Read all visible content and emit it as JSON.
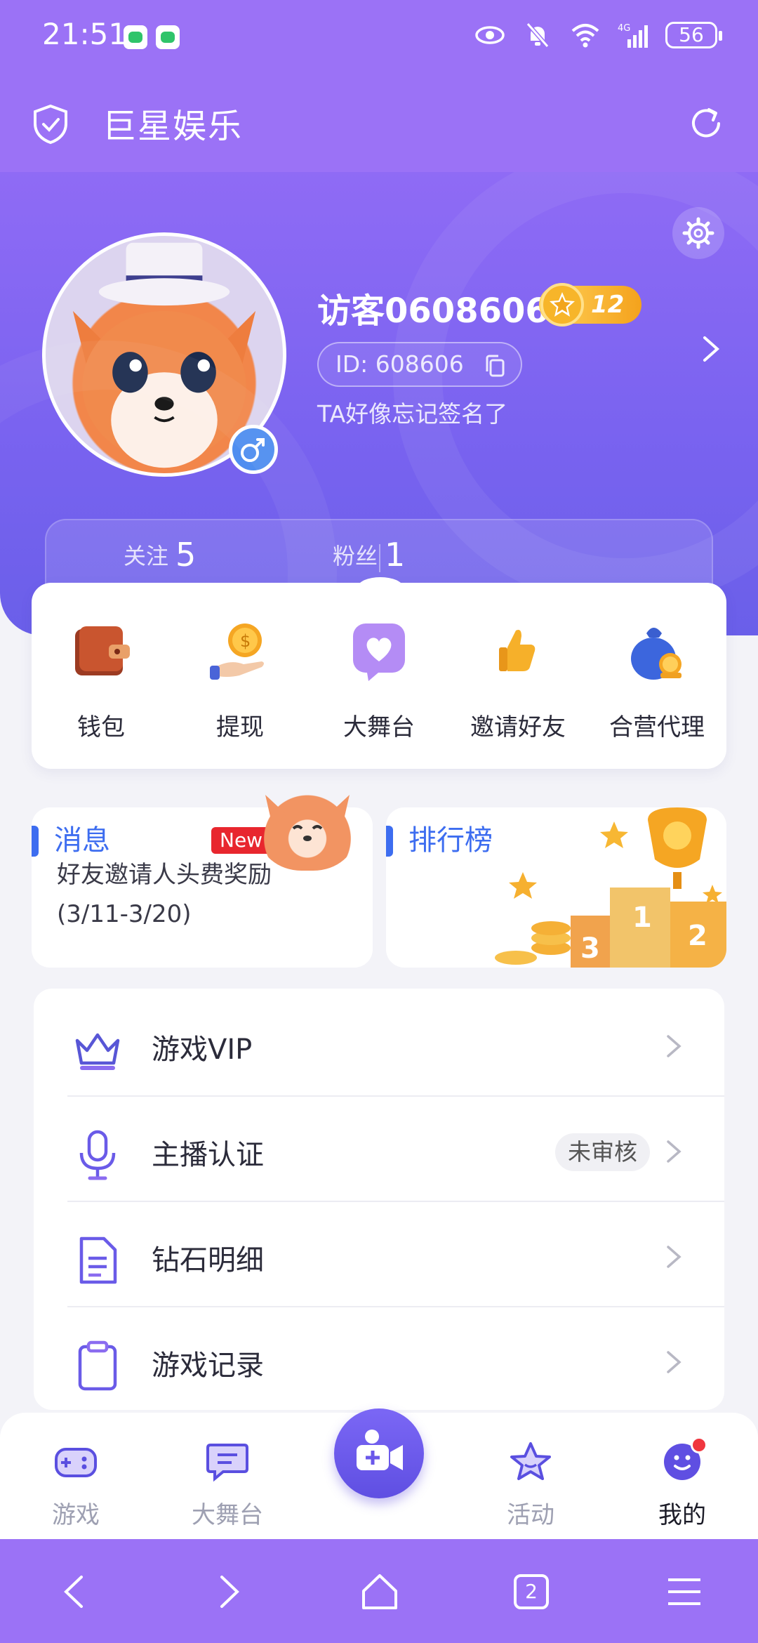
{
  "status_bar": {
    "time": "21:51",
    "network": "4G",
    "battery": "56"
  },
  "app_bar": {
    "title": "巨星娱乐"
  },
  "profile": {
    "username": "访客0608606",
    "level": "12",
    "id_text": "ID: 608606",
    "signature": "TA好像忘记签名了",
    "follow_label": "关注",
    "follow_count": "5",
    "fans_label": "粉丝",
    "fans_count": "1"
  },
  "quick_actions": [
    {
      "label": "钱包",
      "icon": "wallet-icon"
    },
    {
      "label": "提现",
      "icon": "withdraw-coin-icon"
    },
    {
      "label": "大舞台",
      "icon": "heart-chat-icon"
    },
    {
      "label": "邀请好友",
      "icon": "thumbs-up-icon"
    },
    {
      "label": "合营代理",
      "icon": "money-bag-icon"
    }
  ],
  "message_card": {
    "title": "消息",
    "new_tag": "New",
    "line1": "好友邀请人头费奖励",
    "line2": "(3/11-3/20)"
  },
  "ranking_card": {
    "title": "排行榜"
  },
  "menu": [
    {
      "label": "游戏VIP",
      "icon": "crown-icon",
      "badge": ""
    },
    {
      "label": "主播认证",
      "icon": "microphone-icon",
      "badge": "未审核"
    },
    {
      "label": "钻石明细",
      "icon": "document-icon",
      "badge": ""
    },
    {
      "label": "游戏记录",
      "icon": "clipboard-icon",
      "badge": ""
    }
  ],
  "tabs": [
    {
      "label": "游戏",
      "icon": "gamepad-icon"
    },
    {
      "label": "大舞台",
      "icon": "chat-bubble-icon"
    },
    {
      "label": "",
      "icon": "video-camera-plus-icon"
    },
    {
      "label": "活动",
      "icon": "star-icon"
    },
    {
      "label": "我的",
      "icon": "smiley-icon",
      "active": true
    }
  ],
  "system_nav": {
    "tab_count": "2"
  },
  "colors": {
    "primary": "#9b72f6",
    "hero": "#7a63f0",
    "accent_blue": "#3d6df0",
    "badge_red": "#e8262e"
  }
}
